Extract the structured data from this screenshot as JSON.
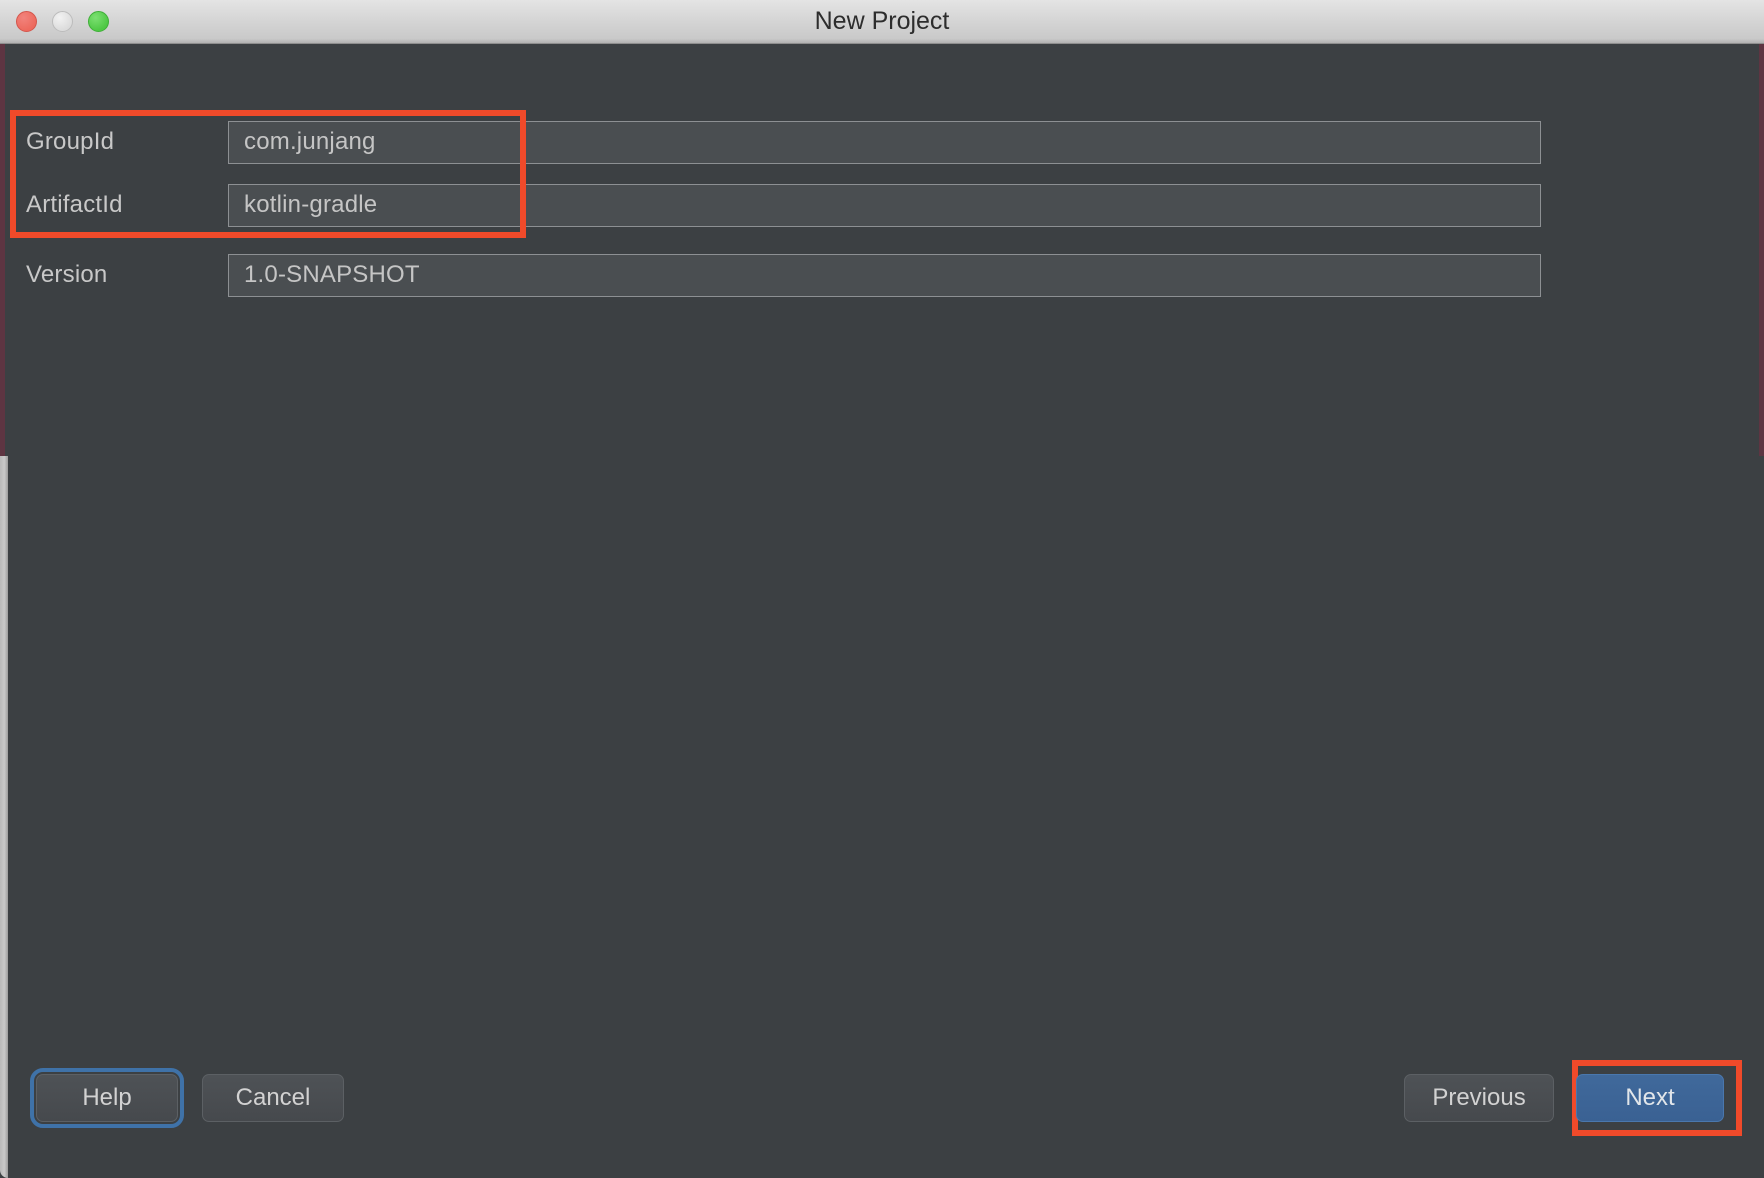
{
  "window": {
    "title": "New Project",
    "traffic_lights": {
      "close": "close-button",
      "minimize": "minimize-button",
      "zoom": "zoom-button"
    }
  },
  "form": {
    "fields": [
      {
        "label": "GroupId",
        "value": "com.junjang"
      },
      {
        "label": "ArtifactId",
        "value": "kotlin-gradle"
      },
      {
        "label": "Version",
        "value": "1.0-SNAPSHOT"
      }
    ]
  },
  "buttons": {
    "help": "Help",
    "cancel": "Cancel",
    "previous": "Previous",
    "next": "Next"
  },
  "annotations": [
    {
      "name": "groupid-artifactid-highlight",
      "color": "#f04a2a"
    },
    {
      "name": "next-button-highlight",
      "color": "#f04a2a"
    }
  ],
  "colors": {
    "dialog_background": "#3c4043",
    "input_background": "#4a4e51",
    "input_border": "#8d9093",
    "default_button": "#3a6193",
    "focus_ring": "#3f72a8",
    "annotation": "#f04a2a",
    "titlebar": "#d6d6d6"
  }
}
